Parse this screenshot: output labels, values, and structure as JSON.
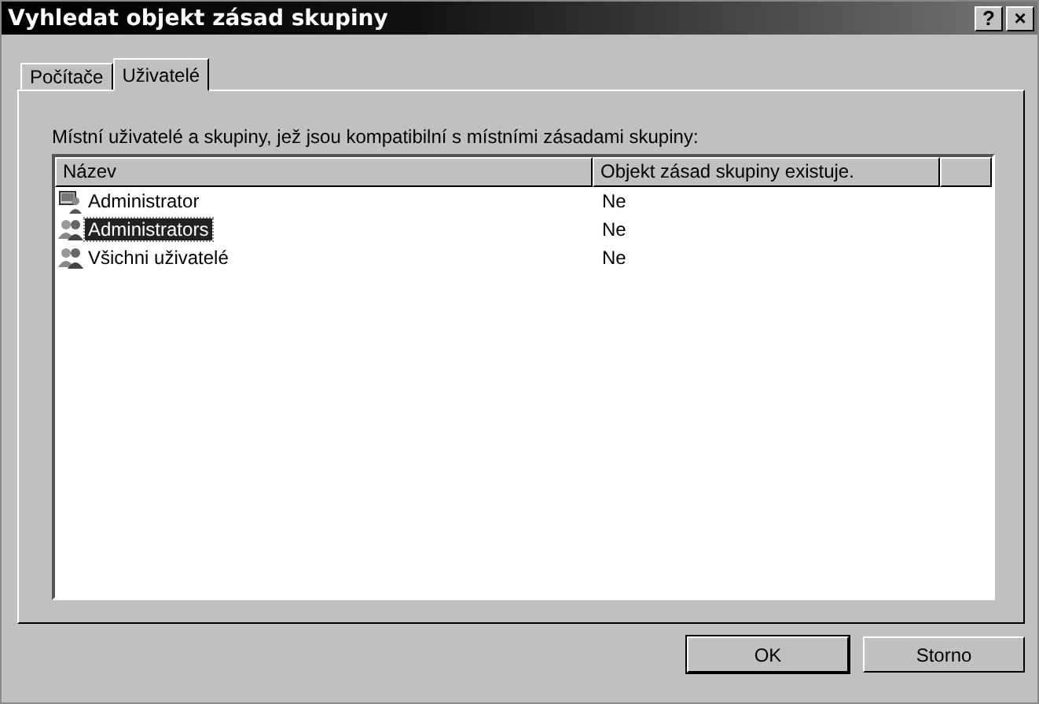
{
  "window": {
    "title": "Vyhledat objekt zásad skupiny",
    "title_buttons": [
      "?",
      "×"
    ]
  },
  "tabs": [
    {
      "label": "Počítače",
      "selected": false
    },
    {
      "label": "Uživatelé",
      "selected": true
    }
  ],
  "list_label": "Místní uživatelé a skupiny, jež jsou kompatibilní s místními zásadami skupiny:",
  "table": {
    "columns": [
      "Název",
      "Objekt zásad skupiny existuje."
    ],
    "rows": [
      {
        "kind": "user",
        "name": "Administrator",
        "exists": "Ne",
        "selected": false
      },
      {
        "kind": "group",
        "name": "Administrators",
        "exists": "Ne",
        "selected": true
      },
      {
        "kind": "group",
        "name": "Všichni uživatelé",
        "exists": "Ne",
        "selected": false
      }
    ]
  },
  "buttons": [
    "OK",
    "Storno"
  ]
}
